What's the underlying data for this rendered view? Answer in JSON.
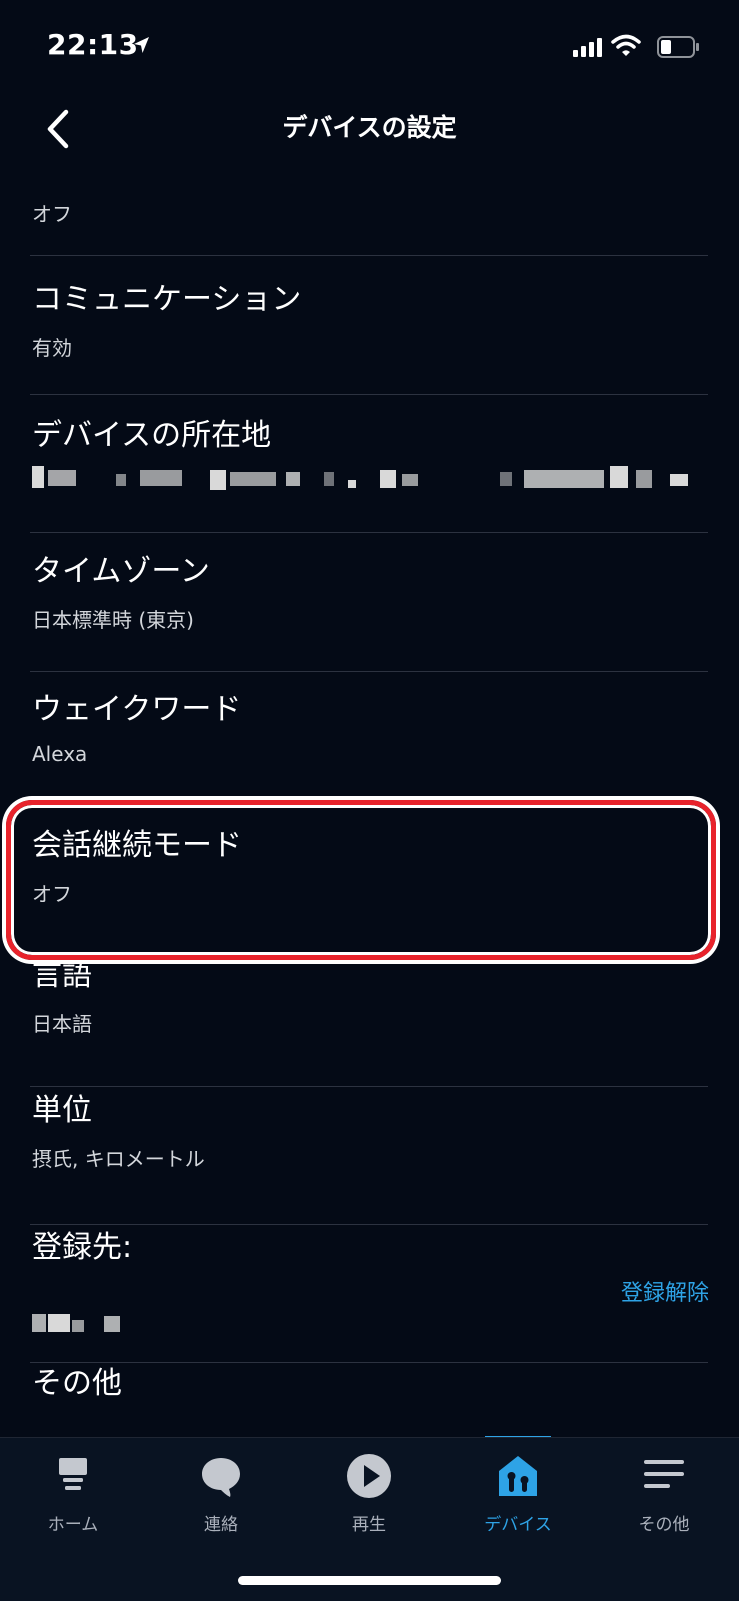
{
  "status_bar": {
    "time": "22:13"
  },
  "header": {
    "title": "デバイスの設定"
  },
  "settings": {
    "top_value": "オフ",
    "communication": {
      "title": "コミュニケーション",
      "value": "有効"
    },
    "device_location": {
      "title": "デバイスの所在地"
    },
    "time_zone": {
      "title": "タイムゾーン",
      "value": "日本標準時 (東京)"
    },
    "wake_word": {
      "title": "ウェイクワード",
      "value": "Alexa"
    },
    "follow_up_mode": {
      "title": "会話継続モード",
      "value": "オフ"
    },
    "language": {
      "title": "言語",
      "value": "日本語"
    },
    "units": {
      "title": "単位",
      "value": "摂氏, キロメートル"
    },
    "registered_to": {
      "title": "登録先:",
      "action": "登録解除"
    },
    "other": {
      "title": "その他"
    }
  },
  "tabbar": {
    "tabs": [
      {
        "label": "ホーム",
        "icon": "home-icon"
      },
      {
        "label": "連絡",
        "icon": "chat-bubble-icon"
      },
      {
        "label": "再生",
        "icon": "play-icon"
      },
      {
        "label": "デバイス",
        "icon": "devices-icon",
        "active": true
      },
      {
        "label": "その他",
        "icon": "menu-icon"
      }
    ]
  },
  "colors": {
    "accent": "#2ea3e6",
    "highlight": "#e8232c",
    "background": "#040a16"
  }
}
